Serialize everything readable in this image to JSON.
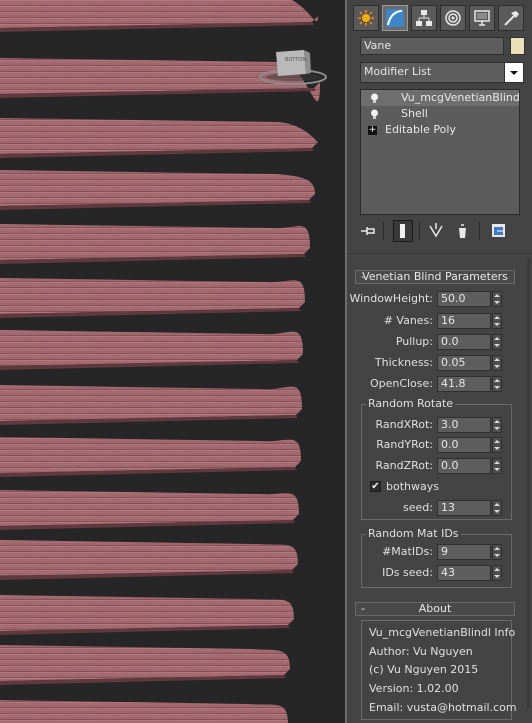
{
  "viewport": {
    "gizmo_label": "BOTTOM"
  },
  "command_panel": {
    "tabs": [
      {
        "name": "create-tab",
        "icon": "sun-icon"
      },
      {
        "name": "modify-tab",
        "icon": "modify-curve-icon",
        "active": true
      },
      {
        "name": "hierarchy-tab",
        "icon": "hierarchy-icon"
      },
      {
        "name": "motion-tab",
        "icon": "motion-icon"
      },
      {
        "name": "display-tab",
        "icon": "display-monitor-icon"
      },
      {
        "name": "utilities-tab",
        "icon": "hammer-icon"
      }
    ],
    "object_name": "Vane",
    "object_color": "#ece0b8",
    "modifier_list": "Modifier List",
    "stack": [
      {
        "label": "Vu_mcgVenetianBlind",
        "icon": "lightbulb-icon",
        "selected": true
      },
      {
        "label": "Shell",
        "icon": "lightbulb-icon",
        "selected": false
      },
      {
        "label": "Editable Poly",
        "icon": "plus-expand-icon",
        "selected": false
      }
    ],
    "stack_tools": [
      "pin-stack-icon",
      "show-end-result-icon",
      "make-unique-icon",
      "remove-modifier-icon",
      "configure-modifier-sets-icon"
    ]
  },
  "venetian": {
    "title": "Venetian Blind Parameters",
    "params": [
      {
        "label": "WindowHeight:",
        "value": "50.0"
      },
      {
        "label": "# Vanes:",
        "value": "16"
      },
      {
        "label": "Pullup:",
        "value": "0.0"
      },
      {
        "label": "Thickness:",
        "value": "0.05"
      },
      {
        "label": "OpenClose:",
        "value": "41.8"
      }
    ],
    "random_rotate": {
      "title": "Random Rotate",
      "params": [
        {
          "label": "RandXRot:",
          "value": "3.0"
        },
        {
          "label": "RandYRot:",
          "value": "0.0"
        },
        {
          "label": "RandZRot:",
          "value": "0.0"
        }
      ],
      "bothways_label": "bothways",
      "bothways_checked": true,
      "seed_label": "seed:",
      "seed_value": "13"
    },
    "random_mat": {
      "title": "Random Mat IDs",
      "matids_label": "#MatIDs:",
      "matids_value": "9",
      "idsseed_label": "IDs seed:",
      "idsseed_value": "43"
    }
  },
  "about": {
    "title": "About",
    "lines": [
      "Vu_mcgVenetianBlindl Info",
      "Author: Vu Nguyen",
      "(c) Vu Nguyen 2015",
      "Version: 1.02.00",
      "Email: vusta@hotmail.com"
    ]
  },
  "rollout_minus": "-"
}
